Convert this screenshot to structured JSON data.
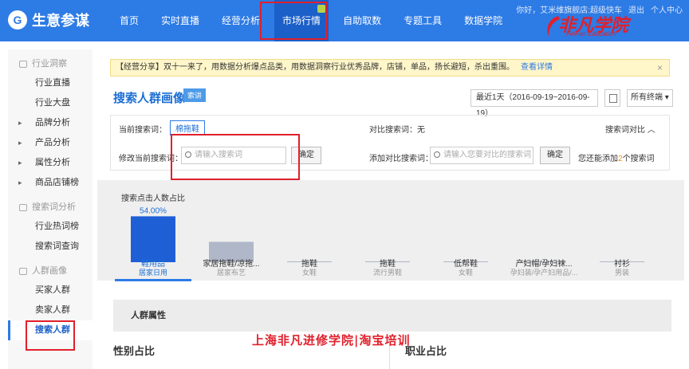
{
  "topbar": {
    "logo_mark": "G",
    "logo_text": "生意参谋",
    "nav": [
      "首页",
      "实时直播",
      "经营分析",
      "市场行情",
      "自助取数",
      "专题工具",
      "数据学院"
    ],
    "user_links": [
      "你好，艾米维旗舰店:超级快车",
      "退出",
      "个人中心"
    ]
  },
  "watermark_logo": {
    "brand": "非凡学院",
    "brand_en": "FeiFan Education"
  },
  "sidebar": {
    "groups": [
      {
        "label": "行业洞察",
        "items": [
          {
            "label": "行业直播"
          },
          {
            "label": "行业大盘"
          },
          {
            "label": "品牌分析"
          },
          {
            "label": "产品分析"
          },
          {
            "label": "属性分析"
          },
          {
            "label": "商品店铺榜"
          }
        ]
      },
      {
        "label": "搜索词分析",
        "items": [
          {
            "label": "行业热词榜"
          },
          {
            "label": "搜索词查询"
          }
        ]
      },
      {
        "label": "人群画像",
        "items": [
          {
            "label": "买家人群"
          },
          {
            "label": "卖家人群"
          },
          {
            "label": "搜索人群"
          }
        ]
      }
    ]
  },
  "notice": {
    "text": "【经营分享】双十一来了，用数据分析爆点品类，用数据洞察行业优秀品牌，店铺，单品，扬长避短，杀出重围。",
    "link": "查看详情",
    "close": "×"
  },
  "page": {
    "title": "搜索人群画像",
    "tag": "索讲",
    "date_range": "最近1天（2016-09-19~2016-09-19）",
    "terminal": "所有终端"
  },
  "query": {
    "current_label": "当前搜索词：",
    "current_term": "棉拖鞋",
    "compare_label": "对比搜索词：无",
    "compare_toggle": "搜索词对比 ︿",
    "modify_label": "修改当前搜索词：",
    "modify_placeholder": "请输入搜索词",
    "confirm": "确定",
    "add_label": "添加对比搜索词：",
    "add_placeholder": "请输入您要对比的搜索词",
    "tip_prefix": "您还能添加",
    "tip_num": "2",
    "tip_suffix": "个搜索词"
  },
  "chart_data": {
    "type": "bar",
    "title": "搜索点击人数占比",
    "categories": [
      "鞋用品 居家日用",
      "家居拖鞋/凉拖... 居家布艺",
      "拖鞋 女鞋",
      "拖鞋 流行男鞋",
      "低帮鞋 女鞋",
      "产妇帽/孕妇袜... 孕妇装/孕产妇用品/...",
      "衬衫 男装"
    ],
    "values": [
      54.0,
      24.0,
      1.0,
      1.0,
      0.8,
      0.6,
      0.5
    ],
    "value_labels": [
      "54.00%"
    ],
    "colors": [
      "#1f5fd6",
      "#b0b7c9",
      "#b0b7c9",
      "#b0b7c9",
      "#b0b7c9",
      "#b0b7c9",
      "#b0b7c9"
    ]
  },
  "categories_display": [
    {
      "l1": "鞋用品",
      "l2": "居家日用"
    },
    {
      "l1": "家居拖鞋/凉拖...",
      "l2": "居家布艺"
    },
    {
      "l1": "拖鞋",
      "l2": "女鞋"
    },
    {
      "l1": "拖鞋",
      "l2": "流行男鞋"
    },
    {
      "l1": "低帮鞋",
      "l2": "女鞋"
    },
    {
      "l1": "产妇帽/孕妇袜...",
      "l2": "孕妇装/孕产妇用品/..."
    },
    {
      "l1": "衬衫",
      "l2": "男装"
    }
  ],
  "sections": {
    "crowd": "人群属性",
    "gender": "性别占比",
    "job": "职业占比"
  },
  "watermark": "上海非凡进修学院|淘宝培训"
}
